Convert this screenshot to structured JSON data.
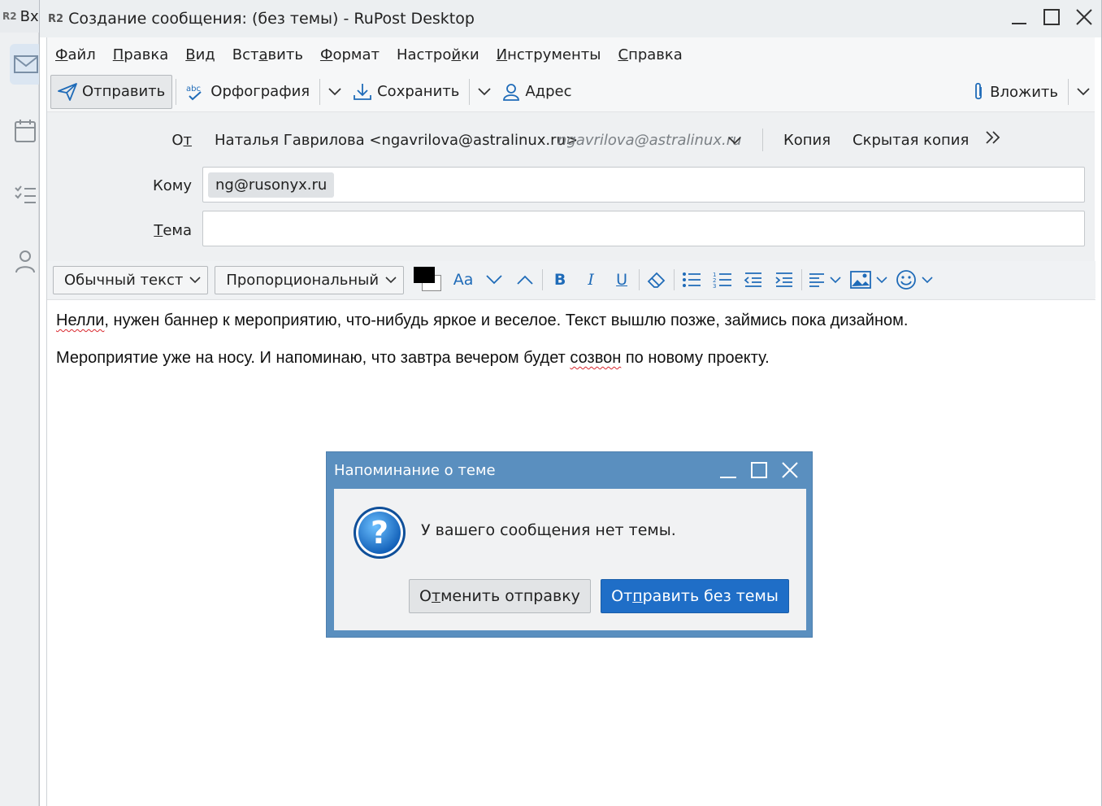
{
  "background_app": {
    "title_fragment": "Вх",
    "logo_text": "R2"
  },
  "window": {
    "logo_text": "R2",
    "title": "Создание сообщения: (без темы) - RuPost Desktop"
  },
  "menu": {
    "items": [
      {
        "prefix": "",
        "ul": "Ф",
        "rest": "айл"
      },
      {
        "prefix": "",
        "ul": "П",
        "rest": "равка"
      },
      {
        "prefix": "",
        "ul": "В",
        "rest": "ид"
      },
      {
        "prefix": "Вст",
        "ul": "а",
        "rest": "вить"
      },
      {
        "prefix": "",
        "ul": "Ф",
        "rest": "ормат"
      },
      {
        "prefix": "Настро",
        "ul": "й",
        "rest": "ки"
      },
      {
        "prefix": "",
        "ul": "И",
        "rest": "нструменты"
      },
      {
        "prefix": "",
        "ul": "С",
        "rest": "правка"
      }
    ]
  },
  "toolbar": {
    "send_label": "Отправить",
    "spelling_label": "Орфография",
    "save_label": "Сохранить",
    "address_label": "Адрес",
    "attach_label": "Вложить"
  },
  "headers": {
    "from_label_pre": "О",
    "from_label_ul": "т",
    "from_value": "Наталья Гаврилова <ngavrilova@astralinux.ru>",
    "from_identity": "ngavrilova@astralinux.ru",
    "cc_label": "Копия",
    "bcc_label": "Скрытая копия",
    "to_label": "Кому",
    "to_recipient": "ng@rusonyx.ru",
    "subject_label_ul": "Т",
    "subject_label_rest": "ема",
    "subject_value": ""
  },
  "format": {
    "paragraph_style": "Обычный текст",
    "font_family": "Пропорциональный",
    "text_color": "#000000",
    "font_size_label": "Aa",
    "bold_label": "B",
    "italic_label": "I",
    "underline_label": "U"
  },
  "body": {
    "line1_spell": "Нелли",
    "line1_rest": ", нужен баннер к мероприятию, что-нибудь яркое и веселое. Текст вышлю позже, займись пока дизайном.",
    "line2_pre": "Мероприятие уже на носу. И напоминаю, что завтра вечером будет ",
    "line2_spell": "созвон",
    "line2_post": " по новому проекту."
  },
  "dialog": {
    "title": "Напоминание о теме",
    "message": "У вашего сообщения нет темы.",
    "cancel_pre": "О",
    "cancel_ul": "т",
    "cancel_rest": "менить отправку",
    "ok_pre": "От",
    "ok_ul": "п",
    "ok_rest": "равить без темы"
  },
  "colors": {
    "accent": "#1f6ec7",
    "dialog_frame": "#5a8fbf",
    "icon_blue": "#1f6bb8",
    "spell_underline": "#d9272e"
  }
}
